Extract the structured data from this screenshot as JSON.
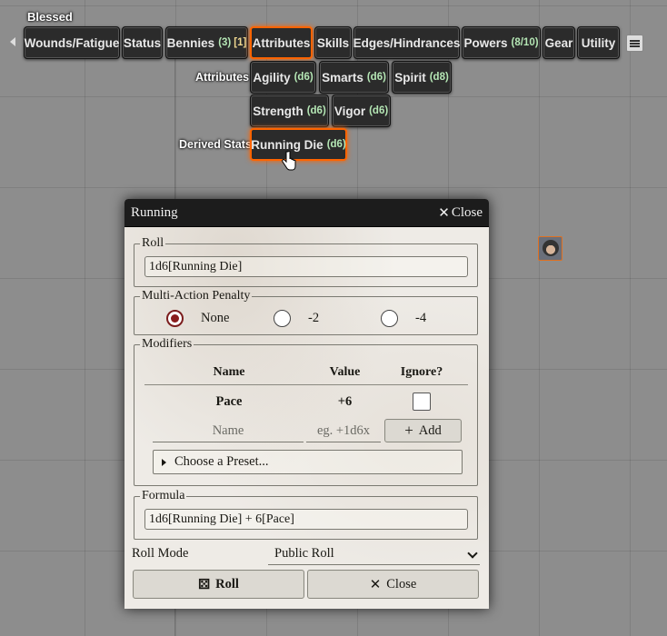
{
  "actor_name": "Blessed",
  "hud": {
    "tabs": [
      {
        "label": "Wounds/Fatigue"
      },
      {
        "label": "Status"
      },
      {
        "label": "Bennies",
        "count": "(3)",
        "extra": "[1]"
      },
      {
        "label": "Attributes",
        "active": true
      },
      {
        "label": "Skills"
      },
      {
        "label": "Edges/Hindrances"
      },
      {
        "label": "Powers",
        "count": "(8/10)"
      },
      {
        "label": "Gear"
      },
      {
        "label": "Utility"
      }
    ],
    "attributes_label": "Attributes",
    "attributes": [
      {
        "label": "Agility",
        "die": "(d6)"
      },
      {
        "label": "Smarts",
        "die": "(d6)"
      },
      {
        "label": "Spirit",
        "die": "(d8)"
      },
      {
        "label": "Strength",
        "die": "(d6)"
      },
      {
        "label": "Vigor",
        "die": "(d6)"
      }
    ],
    "derived_label": "Derived Stats",
    "derived": [
      {
        "label": "Running Die",
        "die": "(d6)",
        "active": true
      }
    ]
  },
  "dialog": {
    "title": "Running",
    "close_label": "Close",
    "roll": {
      "legend": "Roll",
      "value": "1d6[Running Die]"
    },
    "map": {
      "legend": "Multi-Action Penalty",
      "options": [
        {
          "label": "None",
          "checked": true
        },
        {
          "label": "-2",
          "checked": false
        },
        {
          "label": "-4",
          "checked": false
        }
      ]
    },
    "modifiers": {
      "legend": "Modifiers",
      "headers": {
        "name": "Name",
        "value": "Value",
        "ignore": "Ignore?"
      },
      "rows": [
        {
          "name": "Pace",
          "value": "+6",
          "ignore": false
        }
      ],
      "name_placeholder": "Name",
      "value_placeholder": "eg. +1d6x",
      "add_label": "Add",
      "preset_label": "Choose a Preset..."
    },
    "formula": {
      "legend": "Formula",
      "value": "1d6[Running Die] + 6[Pace]"
    },
    "roll_mode": {
      "label": "Roll Mode",
      "selected": "Public Roll"
    },
    "roll_button": "Roll",
    "close_button": "Close"
  },
  "colors": {
    "hud_active_border": "#ff6400",
    "die_text": "#b4e6b4",
    "count_text": "#e1b8f0",
    "radio_checked": "#8a1d1d",
    "header_bg": "#1c1c1c"
  }
}
